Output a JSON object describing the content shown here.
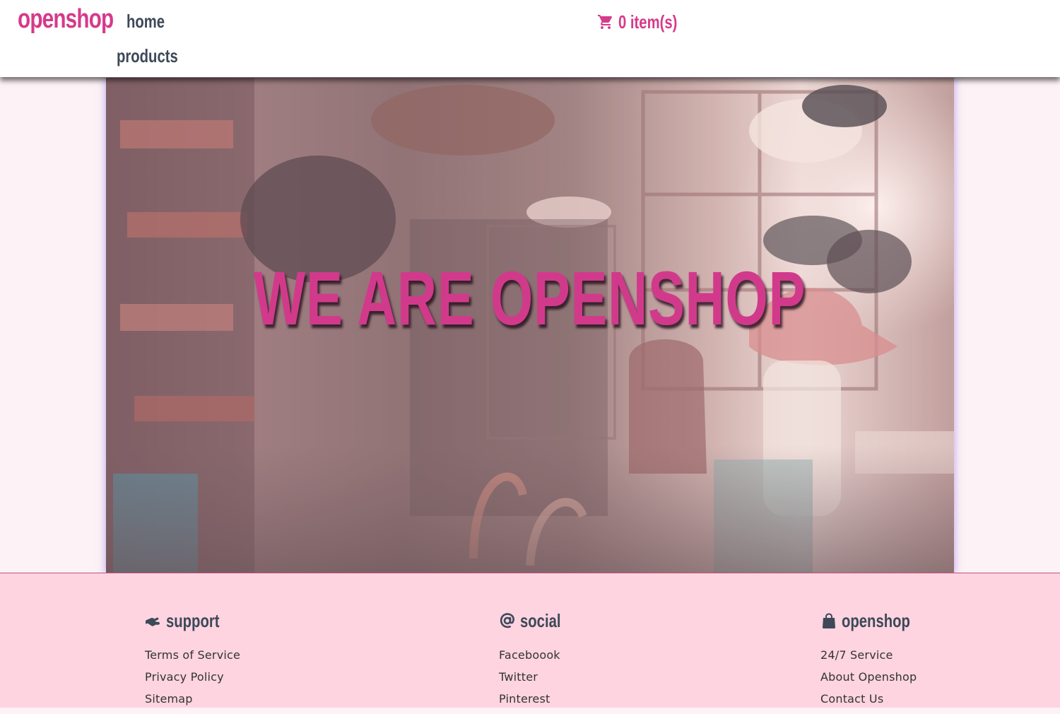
{
  "header": {
    "logo": "openshop",
    "nav": {
      "home": "home",
      "products": "products"
    },
    "cart": {
      "icon": "cart-icon",
      "label": "0 item(s)"
    }
  },
  "hero": {
    "title": "WE ARE OPENSHOP"
  },
  "footer": {
    "columns": [
      {
        "icon": "handshake-icon",
        "title": "support",
        "links": [
          "Terms of Service",
          "Privacy Policy",
          "Sitemap"
        ]
      },
      {
        "icon": "at-icon",
        "title": "social",
        "links": [
          "Faceboook",
          "Twitter",
          "Pinterest"
        ]
      },
      {
        "icon": "shopping-bag-icon",
        "title": "openshop",
        "links": [
          "24/7 Service",
          "About Openshop",
          "Contact Us"
        ]
      }
    ]
  },
  "colors": {
    "brand": "#d63a8a",
    "nav_text": "#3d4858",
    "footer_bg": "#fdd4e0",
    "page_bg": "#fdf2f5"
  }
}
